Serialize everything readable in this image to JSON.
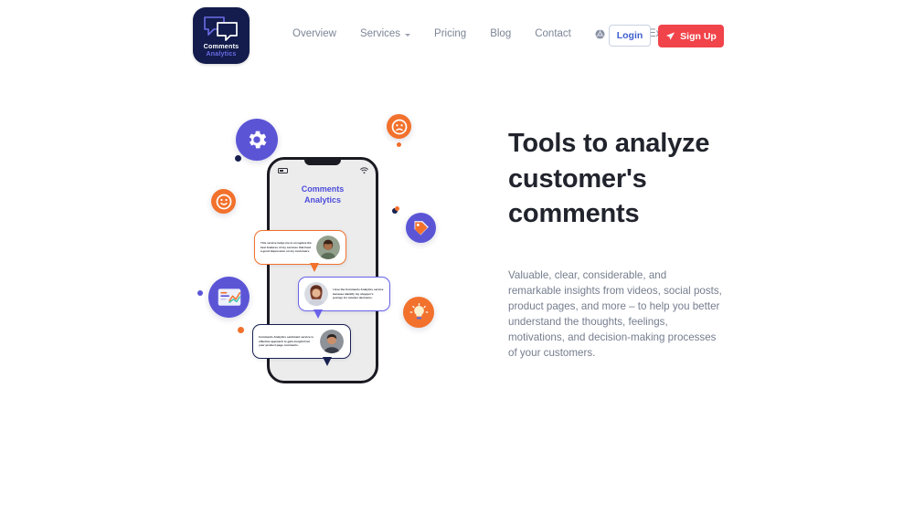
{
  "brand": {
    "logo_line1": "Comments",
    "logo_line2": "Analytics",
    "logo_icon": "speech-bubbles-icon"
  },
  "nav": {
    "items": [
      {
        "label": "Overview",
        "has_caret": false,
        "icon": null
      },
      {
        "label": "Services",
        "has_caret": true,
        "icon": null
      },
      {
        "label": "Pricing",
        "has_caret": false,
        "icon": null
      },
      {
        "label": "Blog",
        "has_caret": false,
        "icon": null
      },
      {
        "label": "Contact",
        "has_caret": false,
        "icon": null
      },
      {
        "label": "Chrome Extension",
        "has_caret": false,
        "icon": "chrome-icon"
      }
    ]
  },
  "actions": {
    "login_label": "Login",
    "signup_label": "Sign Up",
    "signup_icon": "paper-plane-icon"
  },
  "hero": {
    "title": "Tools to analyze customer's comments",
    "paragraph": "Valuable, clear, considerable, and remarkable insights from videos, social posts, product pages, and more – to help you better understand the thoughts, feelings, motivations, and decision-making processes of your customers."
  },
  "illustration": {
    "phone_brand_line1": "Comments",
    "phone_brand_line2": "Analytics",
    "comments": [
      {
        "text": "This service helps me to recognize the best features of my services that have a good impression on my customers.",
        "accent": "#f2712c",
        "avatar_side": "right",
        "avatar": "avatar-man-1"
      },
      {
        "text": "I love the Comments Analytics service because identify my shopper's journey for smarter decisions.",
        "accent": "#6a63e8",
        "avatar_side": "left",
        "avatar": "avatar-woman-1"
      },
      {
        "text": "Comments Analytics sentiment service is effective approach to gain insight from your product page comments.",
        "accent": "#18204f",
        "avatar_side": "right",
        "avatar": "avatar-man-2"
      }
    ],
    "badges": [
      {
        "icon": "gear-icon",
        "color": "#5b55d6"
      },
      {
        "icon": "sad-face-icon",
        "color": "#f2712c"
      },
      {
        "icon": "smile-face-icon",
        "color": "#f2712c"
      },
      {
        "icon": "price-tag-icon",
        "color": "#5b55d6"
      },
      {
        "icon": "chart-card-icon",
        "color": "#5b55d6"
      },
      {
        "icon": "lightbulb-icon",
        "color": "#f2712c"
      }
    ]
  },
  "colors": {
    "primary_purple": "#5b55d6",
    "accent_orange": "#f2712c",
    "signup_red": "#f0444a",
    "navy": "#18204f",
    "login_blue": "#3f5fd0",
    "heading": "#21242c",
    "body_text": "#757d8e",
    "nav_text": "#7c8596"
  }
}
